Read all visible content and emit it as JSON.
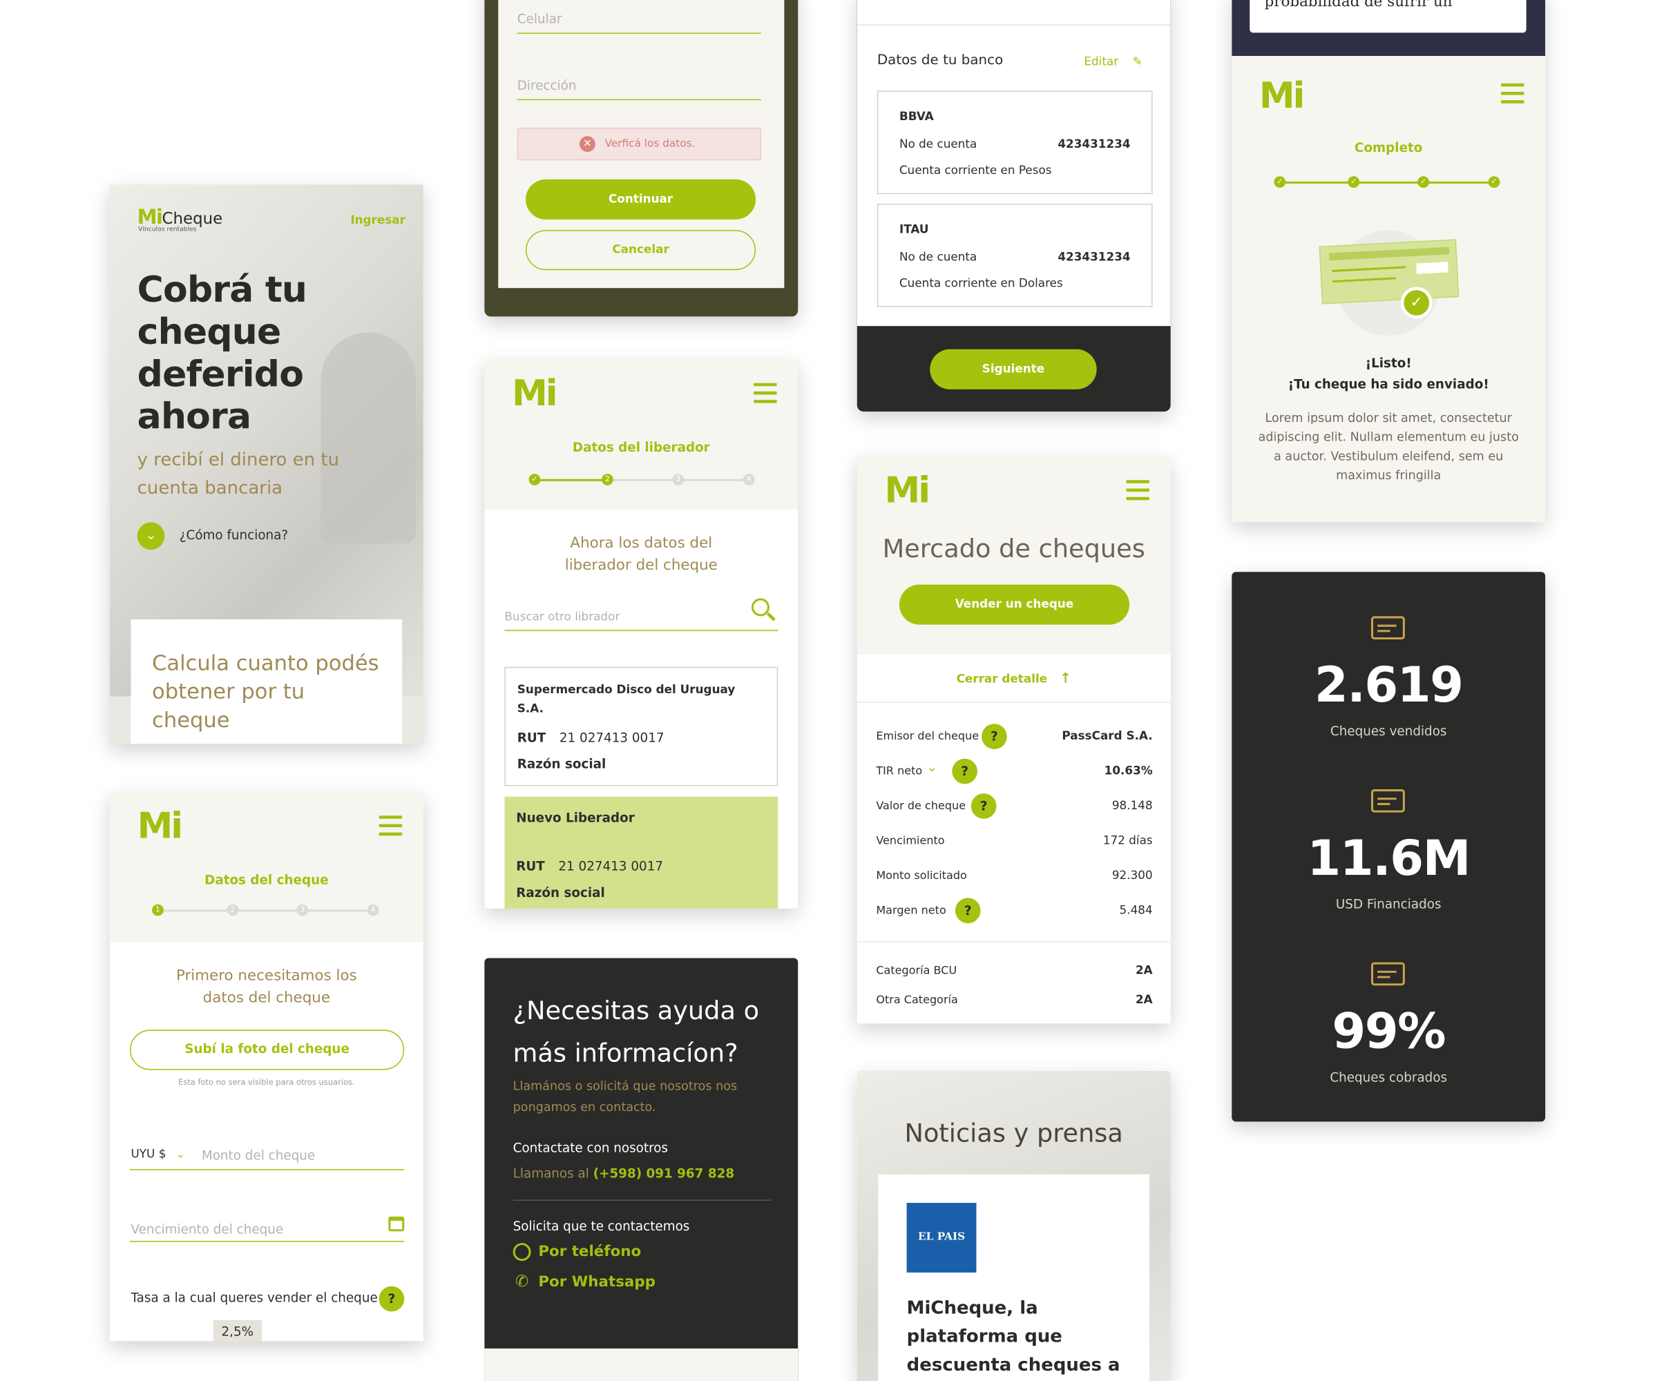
{
  "colors": {
    "accent": "#a6c20f",
    "dark": "#2a2a28",
    "olive": "#a08a55",
    "background": "#f6f5f0"
  },
  "hero": {
    "logo_mi": "Mi",
    "logo_cheque": "Cheque",
    "logo_tagline": "Vínculos rentables",
    "login": "Ingresar",
    "title": "Cobrá tu cheque deferido ahora",
    "subtitle": "y recibí el dinero en tu cuenta bancaria",
    "how": "¿Cómo funciona?",
    "calc": "Calcula cuanto podés obtener por tu cheque"
  },
  "form_top": {
    "celular": "Celular",
    "direccion": "Dirección",
    "error": "Verficá los datos.",
    "continue": "Continuar",
    "cancel": "Cancelar"
  },
  "cheque_data": {
    "step_title": "Datos del cheque",
    "steps": [
      "1",
      "2",
      "3",
      "4"
    ],
    "heading": "Primero necesitamos los datos del cheque",
    "upload": "Subí la foto del cheque",
    "upload_note": "Esta foto no sera visible para otros usuarios.",
    "currency": "UYU $",
    "amount_placeholder": "Monto del cheque",
    "due_placeholder": "Vencimiento del cheque",
    "rate_label": "Tasa a la cual queres vender el cheque",
    "rate_value": "2,5%"
  },
  "liberador": {
    "step_title": "Datos del liberador",
    "heading": "Ahora los datos del liberador del cheque",
    "search_placeholder": "Buscar otro librador",
    "company_name": "Supermercado Disco del Uruguay S.A.",
    "rut_label": "RUT",
    "rut_value": "21 027413 0017",
    "razon_label": "Razón social",
    "new_title": "Nuevo Liberador",
    "new_rut_label": "RUT",
    "new_rut_value": "21 027413 0017",
    "new_razon_label": "Razón social"
  },
  "help": {
    "title": "¿Necesitas ayuda o más informacíon?",
    "subtitle": "Llamános o solicitá que nosotros nos pongamos en contacto.",
    "contact_title": "Contactate con nosotros",
    "call_prefix": "Llamanos al",
    "phone": "(+598) 091 967 828",
    "request_title": "Solicita que te contactemos",
    "by_phone": "Por teléfono",
    "by_whatsapp": "Por Whatsapp"
  },
  "bank": {
    "title": "Datos de tu banco",
    "edit": "Editar",
    "accounts": [
      {
        "bank": "BBVA",
        "account_label": "No de cuenta",
        "account_number": "423431234",
        "type": "Cuenta corriente en Pesos"
      },
      {
        "bank": "ITAU",
        "account_label": "No de cuenta",
        "account_number": "423431234",
        "type": "Cuenta corriente en Dolares"
      }
    ],
    "next": "Siguiente"
  },
  "market": {
    "title": "Mercado de cheques",
    "sell": "Vender un cheque",
    "close": "Cerrar detalle",
    "rows": [
      {
        "label": "Emisor del cheque",
        "value": "PassCard S.A.",
        "help": "?"
      },
      {
        "label": "TIR neto",
        "value": "10.63%",
        "help": "?"
      },
      {
        "label": "Valor de cheque",
        "value": "98.148",
        "help": "?"
      },
      {
        "label": "Vencimiento",
        "value": "172 días"
      },
      {
        "label": "Monto solicitado",
        "value": "92.300"
      },
      {
        "label": "Margen neto",
        "value": "5.484",
        "help": "?"
      }
    ],
    "cat1_label": "Categoría BCU",
    "cat1_value": "2A",
    "cat2_label": "Otra Categoría",
    "cat2_value": "2A"
  },
  "news": {
    "title": "Noticias y prensa",
    "source": "EL PAIS",
    "headline": "MiCheque, la plataforma que descuenta cheques a"
  },
  "done": {
    "top_text": "probabilidad de sufrir un",
    "step_title": "Completo",
    "ready": "¡Listo!",
    "sent": "¡Tu cheque ha sido enviado!",
    "body": "Lorem ipsum dolor sit amet, consectetur adipiscing elit. Nullam elementum eu justo a auctor. Vestibulum eleifend, sem eu maximus fringilla"
  },
  "stats": [
    {
      "value": "2.619",
      "label": "Cheques vendidos",
      "icon": "cheque-icon"
    },
    {
      "value": "11.6M",
      "label": "USD Financiados",
      "icon": "money-icon"
    },
    {
      "value": "99%",
      "label": "Cheques cobrados",
      "icon": "wallet-icon"
    }
  ]
}
